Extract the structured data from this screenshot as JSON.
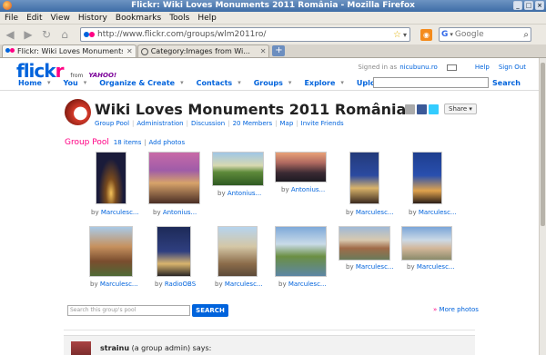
{
  "window": {
    "title": "Flickr: Wiki Loves Monuments 2011 România - Mozilla Firefox"
  },
  "menu": [
    "File",
    "Edit",
    "View",
    "History",
    "Bookmarks",
    "Tools",
    "Help"
  ],
  "nav": {
    "back": "◀",
    "forward": "▶",
    "reload": "↻",
    "home": "⌂"
  },
  "urlbar": {
    "url": "http://www.flickr.com/groups/wlm2011ro/"
  },
  "search": {
    "engine": "G",
    "placeholder": "Google"
  },
  "tabs": [
    {
      "label": "Flickr: Wiki Loves Monuments 2...",
      "active": true
    },
    {
      "label": "Category:Images from Wi...",
      "active": false
    }
  ],
  "flickr": {
    "logo_part1": "flick",
    "logo_part2": "r",
    "logo_from": "from",
    "logo_yahoo": "YAHOO!",
    "signed_in_text": "Signed in as",
    "username": "nicubunu.ro",
    "links": [
      "Help",
      "Sign Out"
    ],
    "nav": [
      "Home",
      "You",
      "Organize & Create",
      "Contacts",
      "Groups",
      "Explore",
      "Upload"
    ],
    "search_button": "Search"
  },
  "group": {
    "title": "Wiki Loves Monuments 2011 România",
    "links": [
      "Group Pool",
      "Administration",
      "Discussion",
      "20 Members",
      "Map",
      "Invite Friends"
    ],
    "share_label": "Share ▾"
  },
  "pool": {
    "heading": "Group Pool",
    "count": "18 items",
    "add": "Add photos",
    "photos": [
      {
        "by": "by",
        "author": "Marculesc..."
      },
      {
        "by": "by",
        "author": "Antonius..."
      },
      {
        "by": "by",
        "author": "Antonius..."
      },
      {
        "by": "by",
        "author": "Antonius..."
      },
      {
        "by": "by",
        "author": "Marculesc..."
      },
      {
        "by": "by",
        "author": "Marculesc..."
      },
      {
        "by": "by",
        "author": "Marculesc..."
      },
      {
        "by": "by",
        "author": "RadioOBS"
      },
      {
        "by": "by",
        "author": "Marculesc..."
      },
      {
        "by": "by",
        "author": "Marculesc..."
      },
      {
        "by": "by",
        "author": "Marculesc..."
      },
      {
        "by": "by",
        "author": "Marculesc..."
      }
    ],
    "search_placeholder": "Search this group's pool",
    "search_button": "SEARCH",
    "more": "More photos"
  },
  "discussion": {
    "author": "strainu",
    "role": "(a group admin) says:"
  }
}
